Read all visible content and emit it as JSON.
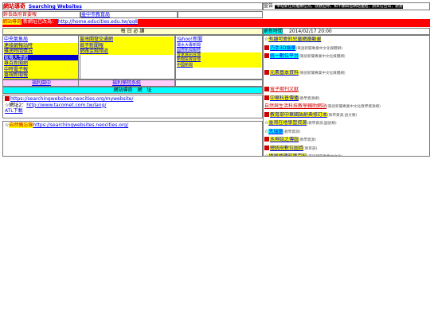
{
  "header": {
    "site_title": "網站導奇",
    "site_title_en": "Searching Websites",
    "menu_items": [
      {
        "label": "幹長政府首要報"
      },
      {
        "label": "臺中市教育局"
      }
    ],
    "notice_prefix": "網站導奇",
    "notice_middle": "新網址已改為：",
    "notice_url": "http://home.educities.edu.tw/qq8"
  },
  "ad_banner": {
    "label": "宣告",
    "text": "*本站新任何推薦任為，就歡迎你，如不願與您網站連結，請來信告知，謝謝"
  },
  "daily": {
    "title": "每 日 必 讀",
    "update_label": "更新時間",
    "update_time": "2014/02/17 20:00"
  },
  "links_col1": [
    "中央氣象局",
    "連接網報站時",
    "雅虎時間情況",
    "電機大學網",
    "專百新聞網",
    "中時電子報",
    "臺視新聞報"
  ],
  "links_col2": [
    "臺灣開發交通網",
    "姬子新聞報",
    "網路金融頻道"
  ],
  "links_col3": [
    "Yahoo!新聞",
    "濁水大專新聞",
    "國際新聞報時",
    "智家資訊台灣",
    "新聞投資台灣",
    "中國新聞"
  ],
  "subnav": {
    "left_link": "福利園中",
    "right_link": "福利學院系統",
    "sub_title": "網站導奇　網　址"
  },
  "url_block": {
    "url1": "https://searchingwebsites.neocities.org/mywebsite/",
    "prefix2": "☆網址2：",
    "url2": "http://www.tacomet.com.tw/lang/",
    "extra": "ATL下載"
  },
  "featured": {
    "star": "☆",
    "title": "自然備忘錄",
    "url": "https://searchingwebsites.neocities.org/"
  },
  "news": [
    {
      "text": "有趣可愛的兒童網路動畫",
      "note": "",
      "hl": "hl-yellow",
      "mark": "star"
    },
    {
      "text": "巧手3D娛樂",
      "note": "(東語新聞專業中文化媒體網)",
      "hl": "hl-cyan",
      "mark": "sq"
    },
    {
      "text": "統一數位平台",
      "note": "(東語新聞專業中文化媒體網)",
      "hl": "hl-cyan",
      "mark": "sq"
    },
    {
      "text": "",
      "note": "",
      "hl": "",
      "mark": ""
    },
    {
      "text": "元素基本資料",
      "note": "(東語新聞專業中文化媒體網)",
      "hl": "hl-yellow",
      "mark": "sq"
    },
    {
      "text": "",
      "note": "",
      "hl": "",
      "mark": ""
    },
    {
      "text": "電子期刊文獻",
      "note": "",
      "hl": "",
      "mark": "sq-red"
    },
    {
      "text": "中華科普傳播",
      "note": "(教學資源網)",
      "hl": "hl-yellow",
      "mark": "sq"
    },
    {
      "text": "自然與生活科技教學輔助網站",
      "note": "(東語新聞專業中文化教學資源網)",
      "hl": "",
      "mark": "red-text"
    },
    {
      "text": "教育部中華國語辭典修訂本",
      "note": "(教學資源,語文類)",
      "hl": "hl-yellow",
      "mark": "sq"
    },
    {
      "text": "臺灣在地學習資源",
      "note": "(教學資源,國語類)",
      "hl": "hl-yellow",
      "mark": "star"
    },
    {
      "text": "天瑞鏡",
      "note": "(教學資源)",
      "hl": "hl-cyan",
      "mark": "star"
    },
    {
      "text": "水神話之傳說",
      "note": "(教學資源)",
      "hl": "hl-yellow",
      "mark": "sq"
    },
    {
      "text": "總統府數位圖資",
      "note": "(教育部)",
      "hl": "hl-yellow",
      "mark": "sq"
    },
    {
      "text": "地圖地理知識百科",
      "note": "(東語新聞專業中文化)",
      "hl": "hl-yellow",
      "mark": "star"
    },
    {
      "text": "",
      "note": "",
      "hl": "",
      "mark": ""
    },
    {
      "text": "中華傳統",
      "note": "(教學資源,語文類)(國家教育)",
      "hl": "hl-cyan",
      "mark": "sq"
    },
    {
      "text": "臺灣文學館",
      "note": "(東語新聞專業中文化媒體網)",
      "hl": "hl-yellow",
      "mark": "sq"
    },
    {
      "text": "國家圖書館",
      "note": "(東語數位，大量資訊)",
      "hl": "hl-cyan",
      "mark": "sq"
    },
    {
      "text": "UiMap世界地圖網",
      "note": "(交通類)",
      "hl": "hl-cyan",
      "mark": "sq"
    },
    {
      "text": "台灣地圖",
      "note": "",
      "hl": "hl-yellow",
      "mark": "star"
    }
  ]
}
